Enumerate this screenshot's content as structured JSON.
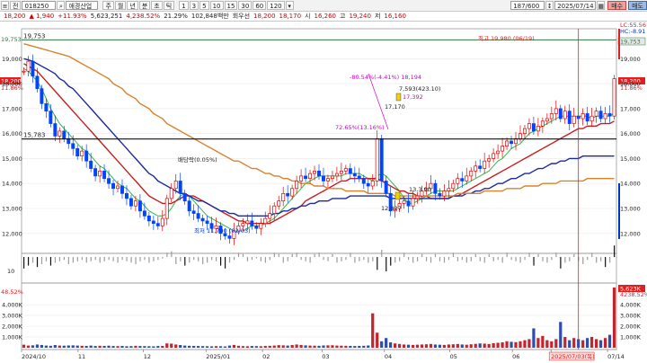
{
  "toolbar": {
    "prefix": "전",
    "code": "018250",
    "name": "애경산업",
    "periods": [
      "주",
      "월",
      "년",
      "분",
      "초",
      "틱"
    ],
    "numbers": [
      "1",
      "3",
      "5",
      "10",
      "15",
      "30",
      "60",
      "120"
    ],
    "count": "187/600",
    "date": "2025/07/14",
    "buy_label": "매수",
    "sell_label": "매도"
  },
  "quote": {
    "price": "18,200",
    "change": "▲ 1,940",
    "rate": "+11.93%",
    "volume": "5,623,251",
    "volume_rate": "4,238.52%",
    "turnover": "21.29%",
    "amount": "102,848백만",
    "amount_label": "회우선",
    "ask": "18,200",
    "bid": "18,170",
    "open_label": "시",
    "open": "16,260",
    "high_label": "고",
    "high": "19,240",
    "low_label": "저",
    "low": "16,160"
  },
  "chart_data": {
    "type": "candlestick",
    "series": [
      {
        "name": "price",
        "values": [
          18500,
          18900,
          18300,
          17800,
          17200,
          16900,
          16400,
          15900,
          16100,
          15800,
          15600,
          15400,
          15100,
          15300,
          14900,
          14600,
          14300,
          14500,
          14200,
          14000,
          13800,
          13900,
          13600,
          13400,
          13100,
          13300,
          12900,
          12700,
          12500,
          12400,
          12300,
          12600,
          13400,
          13800,
          14100,
          13600,
          13300,
          12900,
          12800,
          12600,
          12500,
          12400,
          12200,
          12300,
          12000,
          11900,
          11800,
          12100,
          12300,
          12400,
          12500,
          12300,
          12200,
          12400,
          12600,
          12800,
          13100,
          13300,
          13600,
          13500,
          13800,
          14100,
          14300,
          14200,
          14400,
          14500,
          14300,
          14100,
          14200,
          14300,
          14400,
          14500,
          14600,
          14400,
          14300,
          14200,
          14000,
          13900,
          14100,
          15800,
          14100,
          13600,
          12900,
          13000,
          13200,
          13300,
          13100,
          13400,
          13500,
          13700,
          13800,
          14000,
          13600,
          13500,
          13700,
          13800,
          14000,
          14200,
          14100,
          14300,
          14500,
          14700,
          14600,
          14900,
          15000,
          15200,
          15300,
          15500,
          15700,
          15600,
          15800,
          16000,
          16200,
          16400,
          16100,
          16300,
          16500,
          16600,
          16800,
          17000,
          16600,
          16900,
          16400,
          16700,
          16600,
          16800,
          16500,
          16700,
          16900,
          16600,
          16800,
          16700,
          18200
        ]
      },
      {
        "name": "ma5",
        "values": [
          18600,
          18500,
          18300,
          18100,
          17800,
          17400,
          17000,
          16700,
          16400,
          16200,
          16000,
          15800,
          15600,
          15400,
          15300,
          15100,
          14900,
          14700,
          14600,
          14400,
          14200,
          14000,
          13900,
          13800,
          13600,
          13400,
          13300,
          13100,
          12900,
          12800,
          12700,
          12700,
          12800,
          13000,
          13300,
          13500,
          13600,
          13500,
          13300,
          13100,
          12900,
          12700,
          12600,
          12500,
          12400,
          12300,
          12200,
          12100,
          12100,
          12100,
          12200,
          12300,
          12300,
          12300,
          12400,
          12500,
          12600,
          12800,
          13000,
          13200,
          13400,
          13600,
          13800,
          14000,
          14100,
          14200,
          14300,
          14300,
          14300,
          14300,
          14300,
          14300,
          14400,
          14400,
          14400,
          14400,
          14300,
          14200,
          14100,
          14300,
          14400,
          14300,
          14100,
          13900,
          13700,
          13400,
          13200,
          13200,
          13300,
          13400,
          13500,
          13600,
          13700,
          13700,
          13700,
          13700,
          13700,
          13800,
          13900,
          14000,
          14100,
          14200,
          14300,
          14400,
          14500,
          14700,
          14900,
          15000,
          15200,
          15400,
          15500,
          15600,
          15800,
          16000,
          16100,
          16200,
          16300,
          16400,
          16500,
          16600,
          16700,
          16700,
          16700,
          16700,
          16700,
          16700,
          16700,
          16600,
          16700,
          16700,
          16700,
          16700,
          16800
        ]
      },
      {
        "name": "ma20",
        "values": [
          18800,
          18700,
          18600,
          18500,
          18300,
          18100,
          17900,
          17700,
          17500,
          17300,
          17100,
          16900,
          16700,
          16500,
          16300,
          16100,
          15900,
          15700,
          15500,
          15300,
          15100,
          14900,
          14700,
          14500,
          14300,
          14100,
          13900,
          13700,
          13500,
          13400,
          13300,
          13200,
          13200,
          13200,
          13300,
          13400,
          13500,
          13500,
          13500,
          13400,
          13300,
          13200,
          13100,
          13000,
          12900,
          12800,
          12700,
          12600,
          12500,
          12500,
          12400,
          12400,
          12400,
          12400,
          12400,
          12400,
          12500,
          12600,
          12700,
          12800,
          12900,
          13000,
          13100,
          13300,
          13400,
          13500,
          13600,
          13700,
          13800,
          13900,
          14000,
          14100,
          14100,
          14200,
          14200,
          14200,
          14200,
          14200,
          14200,
          14200,
          14100,
          14000,
          13900,
          13800,
          13700,
          13700,
          13600,
          13600,
          13500,
          13500,
          13500,
          13400,
          13400,
          13400,
          13400,
          13400,
          13500,
          13500,
          13600,
          13700,
          13800,
          13900,
          14000,
          14100,
          14200,
          14300,
          14400,
          14500,
          14600,
          14700,
          14800,
          14900,
          15000,
          15100,
          15200,
          15300,
          15400,
          15500,
          15600,
          15700,
          15800,
          15900,
          16000,
          16100,
          16200,
          16200,
          16300,
          16300,
          16300,
          16400,
          16400,
          16400,
          16500
        ]
      },
      {
        "name": "ma60",
        "values": [
          19000,
          18950,
          18900,
          18800,
          18700,
          18600,
          18500,
          18400,
          18200,
          18100,
          17900,
          17800,
          17600,
          17400,
          17200,
          17000,
          16800,
          16600,
          16400,
          16200,
          16000,
          15800,
          15600,
          15400,
          15200,
          15000,
          14800,
          14600,
          14400,
          14300,
          14100,
          14000,
          13900,
          13800,
          13700,
          13600,
          13600,
          13500,
          13400,
          13300,
          13300,
          13200,
          13100,
          13000,
          12900,
          12900,
          12800,
          12800,
          12700,
          12700,
          12700,
          12700,
          12700,
          12700,
          12700,
          12700,
          12800,
          12800,
          12900,
          12900,
          13000,
          13000,
          13100,
          13100,
          13200,
          13200,
          13300,
          13300,
          13300,
          13400,
          13400,
          13400,
          13400,
          13500,
          13500,
          13500,
          13500,
          13500,
          13500,
          13500,
          13500,
          13500,
          13400,
          13400,
          13400,
          13400,
          13400,
          13400,
          13400,
          13400,
          13400,
          13400,
          13400,
          13400,
          13400,
          13400,
          13500,
          13500,
          13500,
          13600,
          13600,
          13700,
          13700,
          13800,
          13800,
          13900,
          14000,
          14000,
          14100,
          14200,
          14200,
          14300,
          14400,
          14400,
          14500,
          14600,
          14600,
          14700,
          14800,
          14800,
          14900,
          14900,
          15000,
          15000,
          15000,
          15100,
          15100,
          15100,
          15100,
          15100,
          15100,
          15100,
          15100
        ]
      },
      {
        "name": "ma120",
        "values": [
          19600,
          19550,
          19500,
          19450,
          19400,
          19350,
          19300,
          19250,
          19200,
          19150,
          19100,
          19000,
          18900,
          18800,
          18700,
          18600,
          18500,
          18400,
          18300,
          18200,
          18000,
          17900,
          17800,
          17600,
          17500,
          17400,
          17200,
          17100,
          17000,
          16800,
          16700,
          16600,
          16400,
          16300,
          16200,
          16100,
          16000,
          15900,
          15800,
          15700,
          15600,
          15500,
          15400,
          15300,
          15200,
          15100,
          15000,
          14900,
          14900,
          14800,
          14700,
          14600,
          14600,
          14500,
          14400,
          14400,
          14300,
          14300,
          14200,
          14200,
          14100,
          14100,
          14000,
          14000,
          14000,
          13900,
          13900,
          13900,
          13800,
          13800,
          13800,
          13800,
          13700,
          13700,
          13700,
          13700,
          13700,
          13600,
          13600,
          13600,
          13600,
          13600,
          13600,
          13500,
          13500,
          13500,
          13500,
          13500,
          13500,
          13500,
          13500,
          13500,
          13500,
          13500,
          13500,
          13500,
          13500,
          13600,
          13600,
          13600,
          13600,
          13600,
          13600,
          13700,
          13700,
          13700,
          13700,
          13700,
          13800,
          13800,
          13800,
          13800,
          13900,
          13900,
          13900,
          13900,
          14000,
          14000,
          14000,
          14000,
          14100,
          14100,
          14100,
          14100,
          14100,
          14100,
          14200,
          14200,
          14200,
          14200,
          14200,
          14200,
          14200
        ]
      }
    ],
    "x_ticks": [
      "2024/10",
      "11",
      "12",
      "2025/01",
      "02",
      "03",
      "04",
      "05",
      "06",
      "2025/07/03(목)",
      "07/14"
    ],
    "y_ticks": [
      "19,000",
      "18,000",
      "17,000",
      "16,000",
      "15,000",
      "14,000",
      "13,000",
      "12,000"
    ],
    "ylim": [
      11200,
      20200
    ],
    "lines": {
      "high_line": "19,753",
      "support_line": "15,783"
    },
    "annotations": {
      "highest": "최고 19,980 (06/19)",
      "lowest": "최저 11,700 (02/03)",
      "drop": "-80.54%(-4.41%) 18,194",
      "mid_a": "7,593(423.10)",
      "mid_b": "17,392",
      "mid_c": "17,170",
      "rise": "72.65%(13.16%)",
      "fall_tag": "배당락(0.05%)",
      "low_mark": "12,827",
      "small": "13,3.90",
      "lc": "LC:55.56",
      "hc": "HC:-8.91"
    },
    "right_labels": {
      "top": "19,753",
      "price": "18,200",
      "pct": "11.86%",
      "vol": "5,623K",
      "vol_pct": "4238.52%"
    },
    "left_labels": {
      "top": "19,753",
      "price": "18,200",
      "pct": "11.86%"
    },
    "volume_ticks": [
      "4,000K",
      "3,000K",
      "2,000K",
      "1,000K"
    ],
    "volume_left_top": "48.52%",
    "osc_label": "10",
    "volume": [
      280,
      200,
      220,
      300,
      250,
      200,
      180,
      250,
      200,
      190,
      210,
      220,
      200,
      180,
      170,
      200,
      160,
      180,
      170,
      190,
      160,
      150,
      170,
      140,
      150,
      180,
      160,
      150,
      140,
      130,
      160,
      170,
      400,
      380,
      300,
      250,
      200,
      180,
      170,
      160,
      150,
      140,
      130,
      150,
      140,
      120,
      200,
      260,
      180,
      150,
      140,
      160,
      150,
      140,
      170,
      180,
      200,
      240,
      220,
      200,
      250,
      300,
      260,
      220,
      200,
      190,
      180,
      210,
      220,
      230,
      200,
      190,
      180,
      170,
      160,
      170,
      180,
      210,
      3200,
      1400,
      600,
      900,
      500,
      400,
      350,
      300,
      280,
      260,
      280,
      300,
      320,
      350,
      300,
      280,
      260,
      300,
      320,
      350,
      300,
      280,
      320,
      360,
      400,
      380,
      350,
      420,
      460,
      500,
      600,
      550,
      520,
      600,
      700,
      800,
      1800,
      900,
      1100,
      700,
      600,
      800,
      2400,
      1000,
      700,
      900,
      800,
      700,
      900,
      1000,
      800,
      700,
      900,
      1200,
      5600
    ],
    "oscillator": [
      -8,
      -6,
      -4,
      -7,
      -5,
      -3,
      -6,
      -4,
      -3,
      -2,
      -5,
      -4,
      -3,
      -2,
      -4,
      -3,
      -2,
      -4,
      -3,
      -2,
      -3,
      -4,
      -2,
      -3,
      -4,
      -5,
      -3,
      -2,
      -4,
      -3,
      -2,
      -1,
      3,
      4,
      -5,
      -3,
      -6,
      -4,
      -2,
      -3,
      -5,
      -4,
      -2,
      -3,
      -6,
      -8,
      -4,
      -2,
      3,
      2,
      -3,
      -2,
      -1,
      -3,
      -4,
      -2,
      3,
      2,
      -4,
      -3,
      2,
      3,
      -2,
      -3,
      -4,
      2,
      3,
      -2,
      -3,
      2,
      -4,
      -3,
      -2,
      3,
      -4,
      -3,
      -2,
      -4,
      -3,
      -9,
      5,
      -10,
      -6,
      -4,
      -3,
      3,
      -2,
      -4,
      -3,
      2,
      -3,
      -4,
      2,
      -3,
      -4,
      -2,
      3,
      -3,
      -2,
      -4,
      -3,
      2,
      -3,
      -4,
      2,
      -3,
      -2,
      -4,
      3,
      -2,
      -3,
      -4,
      -2,
      3,
      -6,
      2,
      -3,
      -4,
      -2,
      3,
      -8,
      -4,
      -3,
      2,
      -3,
      -5,
      -2,
      3,
      -4,
      -3,
      -7,
      -4,
      8
    ]
  },
  "colors": {
    "up": "#e60000",
    "down": "#0044ff",
    "ma5": "#2db84b",
    "ma20": "#c81e1e",
    "ma60": "#1c2a9e",
    "ma120": "#d9822b"
  }
}
